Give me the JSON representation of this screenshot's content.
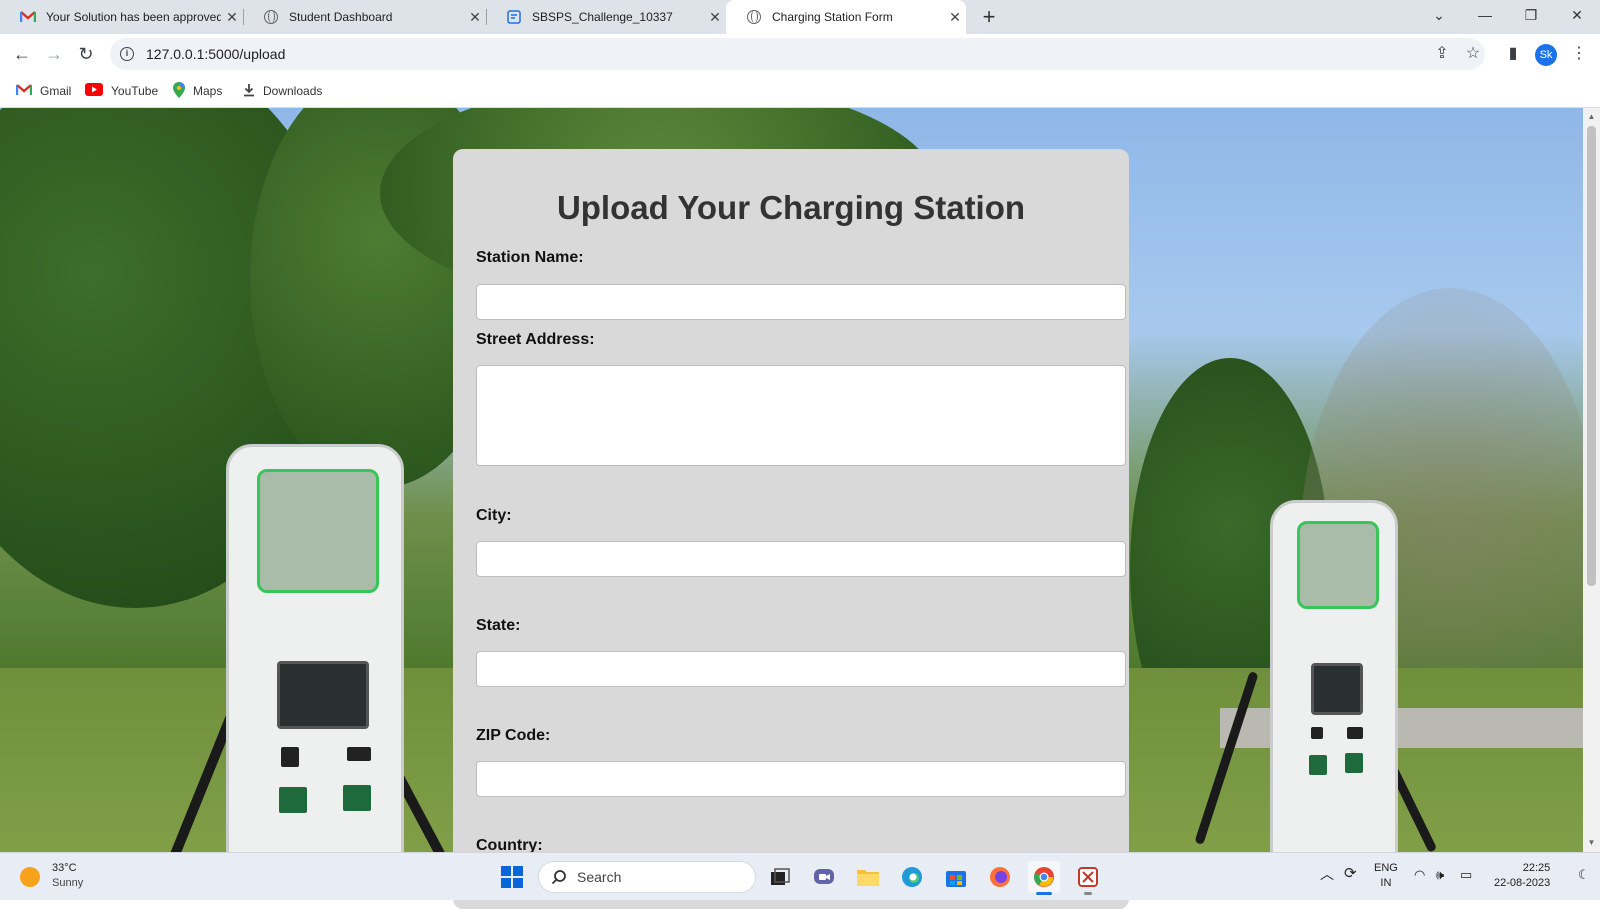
{
  "tabs": [
    {
      "title": "Your Solution has been approved",
      "icon": "gmail-icon"
    },
    {
      "title": "Student Dashboard",
      "icon": "globe-icon"
    },
    {
      "title": "SBSPS_Challenge_10337",
      "icon": "form-icon"
    },
    {
      "title": "Charging Station Form",
      "icon": "globe-icon"
    }
  ],
  "address_bar": {
    "url": "127.0.0.1:5000/upload"
  },
  "profile": {
    "initials": "Sk",
    "color": "#1a73e8"
  },
  "bookmarks": [
    "Gmail",
    "YouTube",
    "Maps",
    "Downloads"
  ],
  "form": {
    "heading": "Upload Your Charging Station",
    "fields": [
      {
        "label": "Station Name:",
        "value": ""
      },
      {
        "label": "Street Address:",
        "value": ""
      },
      {
        "label": "City:",
        "value": ""
      },
      {
        "label": "State:",
        "value": ""
      },
      {
        "label": "ZIP Code:",
        "value": ""
      },
      {
        "label": "Country:",
        "value": ""
      }
    ]
  },
  "taskbar": {
    "weather": {
      "temp": "33°C",
      "condition": "Sunny"
    },
    "search_placeholder": "Search",
    "language": {
      "line1": "ENG",
      "line2": "IN"
    },
    "clock": {
      "time": "22:25",
      "date": "22-08-2023"
    }
  }
}
